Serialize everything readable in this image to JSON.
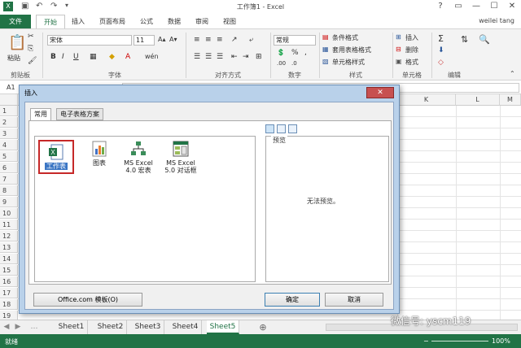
{
  "window": {
    "title": "工作簿1 - Excel",
    "user": "weilei tang",
    "controls": [
      "?",
      "▭",
      "—",
      "☐",
      "✕"
    ]
  },
  "ribbon_tabs": [
    "文件",
    "开始",
    "插入",
    "页面布局",
    "公式",
    "数据",
    "审阅",
    "视图"
  ],
  "ribbon": {
    "paste_label": "粘贴",
    "font_name": "宋体",
    "font_size": "11",
    "number_format": "常规",
    "cond_format": "条件格式",
    "table_format": "套用表格格式",
    "cell_style": "单元格样式",
    "insert": "插入",
    "delete": "删除",
    "format": "格式",
    "groups": [
      "剪贴板",
      "字体",
      "对齐方式",
      "数字",
      "样式",
      "单元格",
      "编辑"
    ]
  },
  "formula_bar": {
    "name_box": "A1"
  },
  "grid": {
    "visible_col_headers": [
      "K",
      "L",
      "M"
    ],
    "rows": [
      "1",
      "2",
      "3",
      "4",
      "5",
      "6",
      "7",
      "8",
      "9",
      "10",
      "11",
      "12",
      "13",
      "14",
      "15",
      "16",
      "17",
      "18",
      "19"
    ]
  },
  "dialog": {
    "title": "插入",
    "close": "✕",
    "tabs": [
      "常用",
      "电子表格方案"
    ],
    "items": [
      {
        "label_lines": [
          "工作表"
        ],
        "icon": "worksheet-icon",
        "selected": true
      },
      {
        "label_lines": [
          "图表"
        ],
        "icon": "chart-icon",
        "selected": false
      },
      {
        "label_lines": [
          "MS Excel",
          "4.0 宏表"
        ],
        "icon": "macro-sheet-icon",
        "selected": false
      },
      {
        "label_lines": [
          "MS Excel",
          "5.0 对话框"
        ],
        "icon": "dialog-sheet-icon",
        "selected": false
      }
    ],
    "preview_label": "预览",
    "preview_empty": "无法预览。",
    "office_button": "Office.com 模板(O)",
    "ok_button": "确定",
    "cancel_button": "取消"
  },
  "sheet_tabs": [
    "Sheet1",
    "Sheet2",
    "Sheet3",
    "Sheet4",
    "Sheet5"
  ],
  "active_sheet": "Sheet5",
  "status": {
    "ready": "就绪",
    "zoom": "100%"
  },
  "watermark": "微信号: yscm119",
  "colors": {
    "accent": "#217346",
    "selection": "#c62828"
  }
}
